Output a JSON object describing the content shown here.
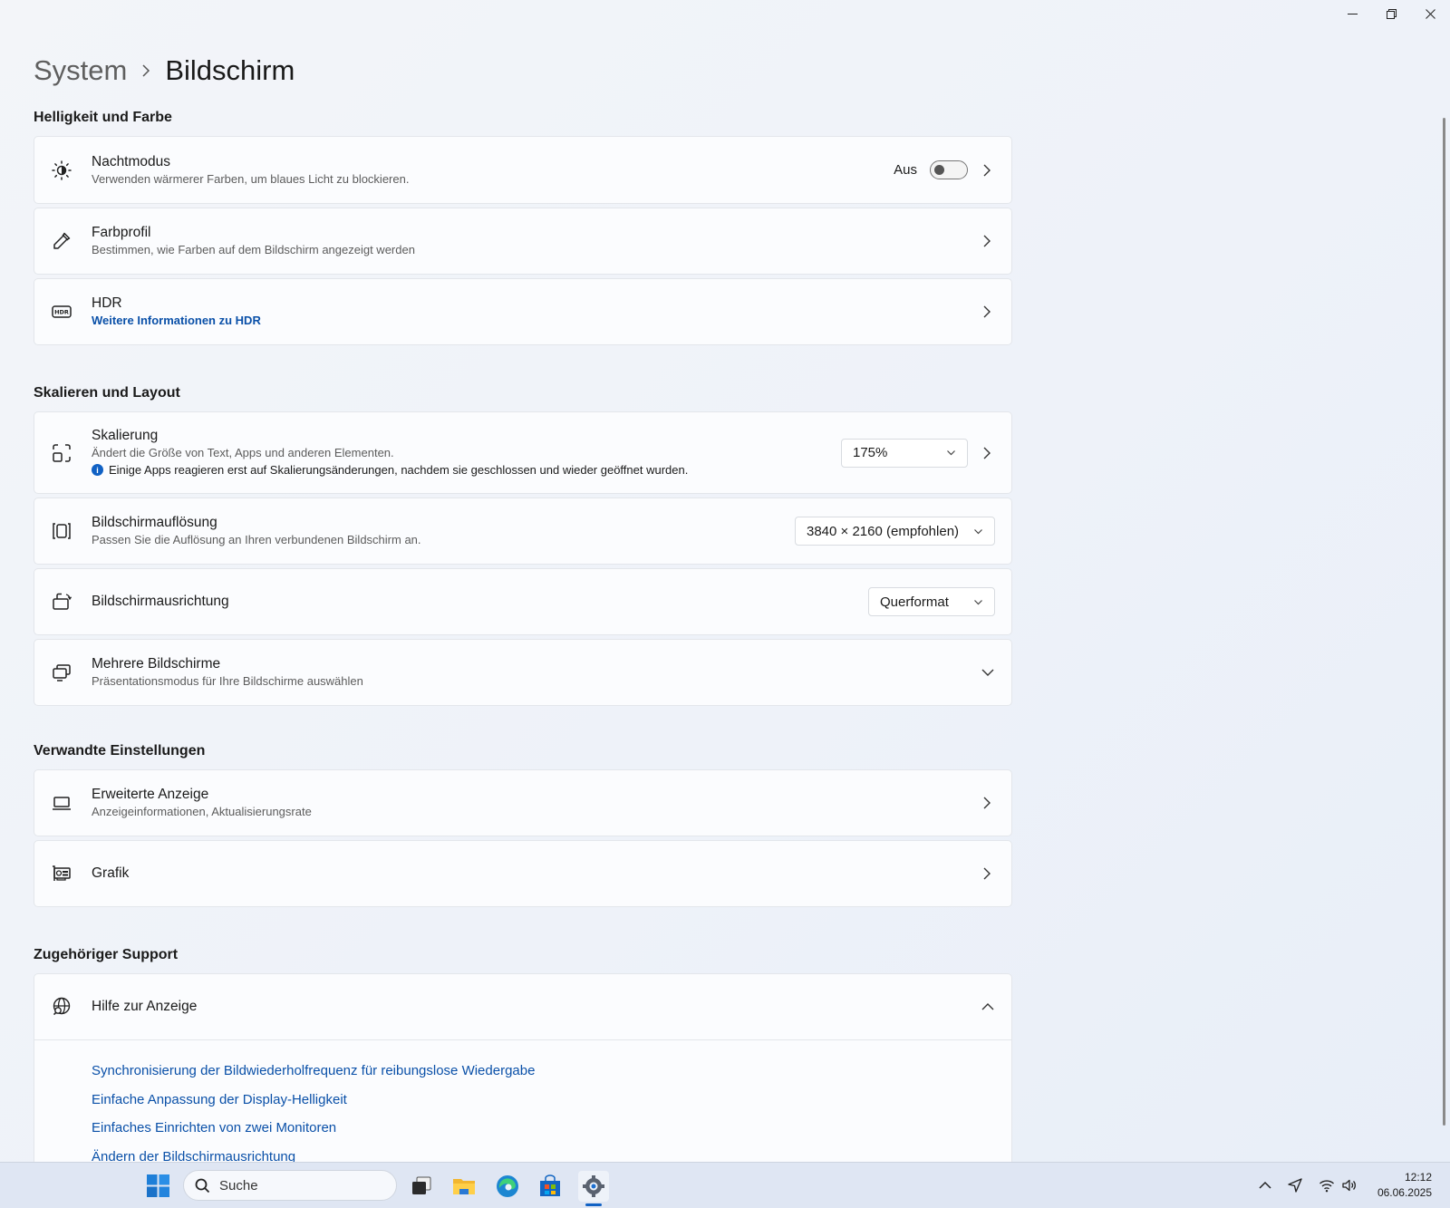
{
  "window": {
    "controls": [
      "minimize",
      "restore",
      "close"
    ]
  },
  "breadcrumb": {
    "parent": "System",
    "current": "Bildschirm"
  },
  "sections": {
    "brightness": {
      "title": "Helligkeit und Farbe",
      "night_mode": {
        "title": "Nachtmodus",
        "subtitle": "Verwenden wärmerer Farben, um blaues Licht zu blockieren.",
        "toggle_label": "Aus",
        "toggle_on": false
      },
      "color_profile": {
        "title": "Farbprofil",
        "subtitle": "Bestimmen, wie Farben auf dem Bildschirm angezeigt werden"
      },
      "hdr": {
        "title": "HDR",
        "link": "Weitere Informationen zu HDR"
      }
    },
    "scale": {
      "title": "Skalieren und Layout",
      "scaling": {
        "title": "Skalierung",
        "subtitle": "Ändert die Größe von Text, Apps und anderen Elementen.",
        "info": "Einige Apps reagieren erst auf Skalierungsänderungen, nachdem sie geschlossen und wieder geöffnet wurden.",
        "value": "175%"
      },
      "resolution": {
        "title": "Bildschirmauflösung",
        "subtitle": "Passen Sie die Auflösung an Ihren verbundenen Bildschirm an.",
        "value": "3840 × 2160 (empfohlen)"
      },
      "orientation": {
        "title": "Bildschirmausrichtung",
        "value": "Querformat"
      },
      "multi": {
        "title": "Mehrere Bildschirme",
        "subtitle": "Präsentationsmodus für Ihre Bildschirme auswählen"
      }
    },
    "related": {
      "title": "Verwandte Einstellungen",
      "advanced": {
        "title": "Erweiterte Anzeige",
        "subtitle": "Anzeigeinformationen, Aktualisierungsrate"
      },
      "graphics": {
        "title": "Grafik"
      }
    },
    "support": {
      "title": "Zugehöriger Support",
      "help": {
        "title": "Hilfe zur Anzeige"
      },
      "links": [
        "Synchronisierung der Bildwiederholfrequenz für reibungslose Wiedergabe",
        "Einfache Anpassung der Display-Helligkeit",
        "Einfaches Einrichten von zwei Monitoren",
        "Ändern der Bildschirmausrichtung"
      ]
    }
  },
  "taskbar": {
    "search_placeholder": "Suche",
    "apps": [
      "windows-start-icon",
      "task-view-icon",
      "file-explorer-icon",
      "edge-icon",
      "store-icon",
      "settings-icon"
    ],
    "time": "12:12",
    "date": "06.06.2025"
  },
  "colors": {
    "accent": "#1061c4",
    "link": "#0a50a8"
  }
}
